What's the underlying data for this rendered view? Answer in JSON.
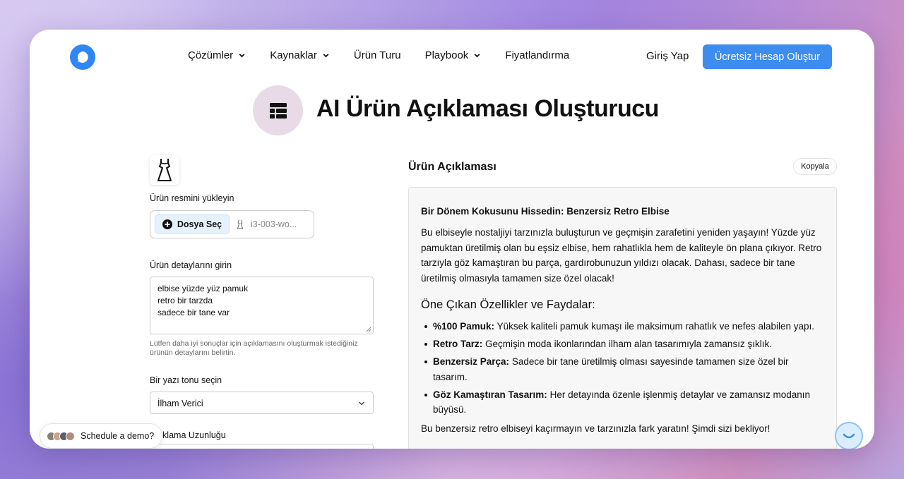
{
  "colors": {
    "accent": "#3d8cf0",
    "hero_circle": "#e9dae7",
    "file_button_bg": "#e6f2fb",
    "output_bg": "#f7f7f8"
  },
  "nav": {
    "logo_icon": "chat-bubble-logo-icon",
    "items": [
      {
        "label": "Çözümler",
        "has_dropdown": true
      },
      {
        "label": "Kaynaklar",
        "has_dropdown": true
      },
      {
        "label": "Ürün Turu",
        "has_dropdown": false
      },
      {
        "label": "Playbook",
        "has_dropdown": true
      },
      {
        "label": "Fiyatlandırma",
        "has_dropdown": false
      }
    ],
    "login_label": "Giriş Yap",
    "cta_label": "Ücretsiz Hesap Oluştur"
  },
  "hero": {
    "icon": "table-icon",
    "title": "AI Ürün Açıklaması Oluşturucu"
  },
  "form": {
    "thumbnail_icon": "dress-icon",
    "upload_label": "Ürün resmini yükleyin",
    "file_button_label": "Dosya Seç",
    "file_name": "i3-003-wo...",
    "details_label": "Ürün detaylarını girin",
    "details_lines": [
      "elbise yüzde yüz pamuk",
      "retro bir tarzda",
      "sadece bir tane var"
    ],
    "details_hint": "Lütfen daha iyi sonuçlar için açıklamasını oluşturmak istediğiniz ürünün detaylarını belirtin.",
    "tone_label": "Bir yazı tonu seçin",
    "tone_value": "İlham Verici",
    "length_label": "Açıklama Uzunluğu"
  },
  "output": {
    "section_title": "Ürün Açıklaması",
    "copy_label": "Kopyala",
    "heading": "Bir Dönem Kokusunu Hissedin: Benzersiz Retro Elbise",
    "intro": "Bu elbiseyle nostaljiyi tarzınızla buluşturun ve geçmişin zarafetini yeniden yaşayın! Yüzde yüz pamuktan üretilmiş olan bu eşsiz elbise, hem rahatlıkla hem de kaliteyle ön plana çıkıyor. Retro tarzıyla göz kamaştıran bu parça, gardırobunuzun yıldızı olacak. Dahası, sadece bir tane üretilmiş olmasıyla tamamen size özel olacak!",
    "features_title": "Öne Çıkan Özellikler ve Faydalar:",
    "features": [
      {
        "term": "%100 Pamuk:",
        "text": "Yüksek kaliteli pamuk kumaşı ile maksimum rahatlık ve nefes alabilen yapı."
      },
      {
        "term": "Retro Tarz:",
        "text": "Geçmişin moda ikonlarından ilham alan tasarımıyla zamansız şıklık."
      },
      {
        "term": "Benzersiz Parça:",
        "text": "Sadece bir tane üretilmiş olması sayesinde tamamen size özel bir tasarım."
      },
      {
        "term": "Göz Kamaştıran Tasarım:",
        "text": "Her detayında özenle işlenmiş detaylar ve zamansız modanın büyüsü."
      }
    ],
    "closing": "Bu benzersiz retro elbiseyi kaçırmayın ve tarzınızla fark yaratın! Şimdi sizi bekliyor!"
  },
  "floating": {
    "demo_label": "Schedule a demo?",
    "chat_icon": "chat-widget-icon"
  }
}
